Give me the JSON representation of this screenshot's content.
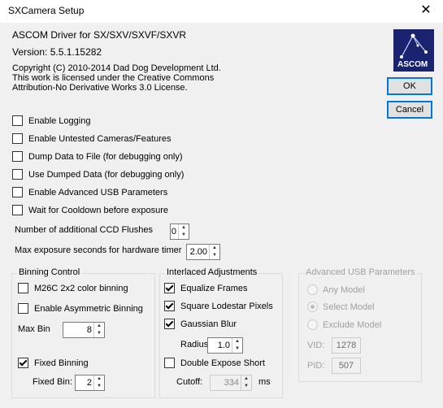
{
  "window": {
    "title": "SXCamera Setup",
    "close_glyph": "✕"
  },
  "header": {
    "driver": "ASCOM Driver for SX/SXV/SXVF/SXVR",
    "version": "Version: 5.5.1.15282",
    "copyright_line1": "Copyright (C) 2010-2014 Dad Dog Development Ltd.",
    "copyright_line2": "This work is licensed under the Creative Commons",
    "copyright_line3": "Attribution-No Derivative Works 3.0 License.",
    "logo_text": "ASCOM"
  },
  "buttons": {
    "ok": "OK",
    "cancel": "Cancel"
  },
  "options": {
    "enable_logging": "Enable Logging",
    "enable_untested": "Enable Untested Cameras/Features",
    "dump_data": "Dump Data to File (for debugging only)",
    "use_dumped": "Use Dumped Data (for debugging only)",
    "advanced_usb": "Enable Advanced USB Parameters",
    "wait_cooldown": "Wait for Cooldown before exposure"
  },
  "flushes": {
    "label": "Number of additional CCD Flushes",
    "value": "0"
  },
  "max_exposure": {
    "label": "Max exposure seconds for hardware timer",
    "value": "2.00"
  },
  "binning": {
    "legend": "Binning Control",
    "m26c": "M26C 2x2 color binning",
    "asymmetric": "Enable Asymmetric Binning",
    "max_bin_label": "Max Bin",
    "max_bin_value": "8",
    "fixed_binning": "Fixed Binning",
    "fixed_bin_label": "Fixed Bin:",
    "fixed_bin_value": "2"
  },
  "interlaced": {
    "legend": "Interlaced Adjustments",
    "equalize": "Equalize Frames",
    "square_lodestar": "Square Lodestar Pixels",
    "gaussian": "Gaussian Blur",
    "radius_label": "Radius:",
    "radius_value": "1.0",
    "double_expose": "Double Expose Short",
    "cutoff_label": "Cutoff:",
    "cutoff_value": "334",
    "cutoff_unit": "ms"
  },
  "advanced_usb_group": {
    "legend": "Advanced USB Parameters",
    "any_model": "Any Model",
    "select_model": "Select Model",
    "exclude_model": "Exclude Model",
    "vid_label": "VID:",
    "vid_value": "1278",
    "pid_label": "PID:",
    "pid_value": "507"
  }
}
